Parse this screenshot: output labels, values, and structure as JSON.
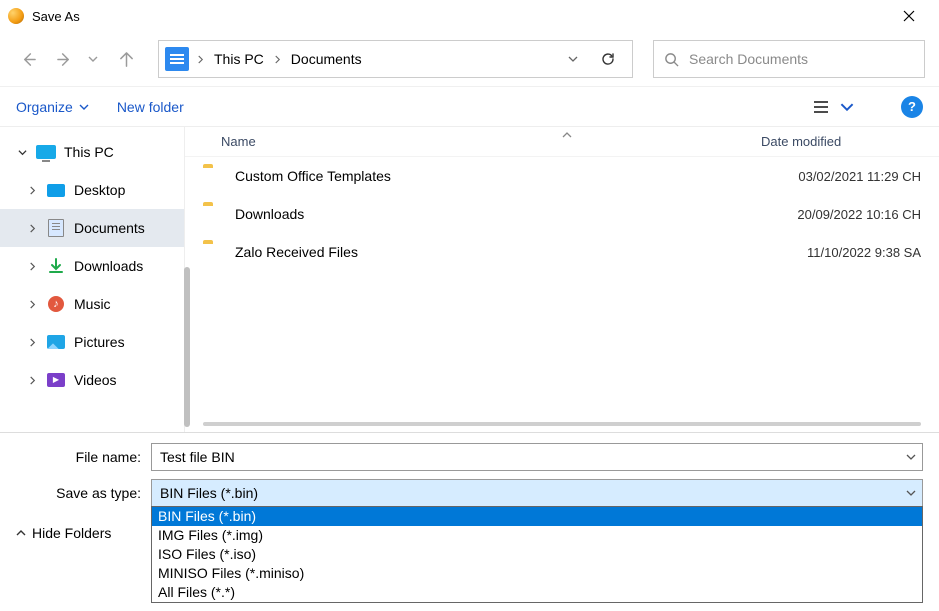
{
  "window": {
    "title": "Save As"
  },
  "breadcrumb": {
    "loc1": "This PC",
    "loc2": "Documents"
  },
  "search": {
    "placeholder": "Search Documents"
  },
  "toolbar": {
    "organize": "Organize",
    "newFolder": "New folder"
  },
  "sidebar": {
    "root": "This PC",
    "items": [
      {
        "label": "Desktop"
      },
      {
        "label": "Documents"
      },
      {
        "label": "Downloads"
      },
      {
        "label": "Music"
      },
      {
        "label": "Pictures"
      },
      {
        "label": "Videos"
      }
    ]
  },
  "columns": {
    "name": "Name",
    "date": "Date modified"
  },
  "files": [
    {
      "name": "Custom Office Templates",
      "date": "03/02/2021 11:29 CH"
    },
    {
      "name": "Downloads",
      "date": "20/09/2022 10:16 CH"
    },
    {
      "name": "Zalo Received Files",
      "date": "11/10/2022 9:38 SA"
    }
  ],
  "form": {
    "fileNameLabel": "File name:",
    "fileNameValue": "Test file BIN",
    "saveTypeLabel": "Save as type:",
    "saveTypeValue": "BIN Files (*.bin)",
    "typeOptions": [
      "BIN Files (*.bin)",
      "IMG Files (*.img)",
      "ISO Files (*.iso)",
      "MINISO Files (*.miniso)",
      "All Files (*.*)"
    ]
  },
  "footer": {
    "hideFolders": "Hide Folders"
  },
  "help": {
    "symbol": "?"
  }
}
